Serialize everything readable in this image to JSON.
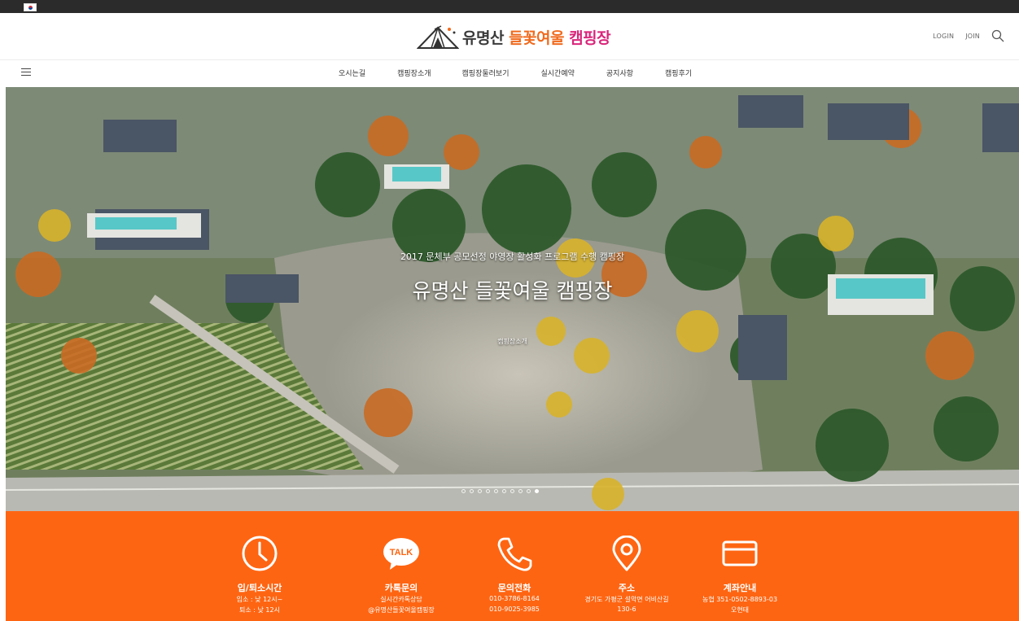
{
  "topbar": {
    "flag_icon": "korea-flag-icon"
  },
  "header": {
    "logo_part1": "유명산 ",
    "logo_part2": "들꽃여울 ",
    "logo_part3": "캠핑장",
    "login_label": "LOGIN",
    "join_label": "JOIN",
    "search_icon": "search-icon"
  },
  "nav": {
    "menu_icon": "hamburger-menu-icon",
    "items": [
      {
        "label": "오시는길"
      },
      {
        "label": "캠핑장소개"
      },
      {
        "label": "캠핑장둘러보기"
      },
      {
        "label": "실시간예약"
      },
      {
        "label": "공지사항"
      },
      {
        "label": "캠핑후기"
      }
    ]
  },
  "hero": {
    "subtitle": "2017 문체부 공모선정 야영장 활성화 프로그램 수행 캠핑장",
    "title": "유명산 들꽃여울 캠핑장",
    "button_label": "캠핑장소개",
    "slide_count": 10,
    "active_slide": 9
  },
  "colors": {
    "accent": "#fe6512",
    "topbar": "#2b2b2b"
  },
  "info": {
    "hours": {
      "icon": "clock-icon",
      "title": "입/퇴소시간",
      "lines": [
        "입소 : 낮 12시~",
        "퇴소 : 낮 12시"
      ]
    },
    "kakao": {
      "icon": "kakao-talk-icon",
      "icon_text": "TALK",
      "title": "카톡문의",
      "lines": [
        "실시간카톡상담",
        "@유명산들꽃여울캠핑장"
      ]
    },
    "phone": {
      "icon": "phone-icon",
      "title": "문의전화",
      "lines": [
        "010-3786-8164",
        "010-9025-3985"
      ]
    },
    "address": {
      "icon": "map-pin-icon",
      "title": "주소",
      "lines": [
        "경기도 가평군 설악면 어비산길",
        "130-6"
      ]
    },
    "account": {
      "icon": "credit-card-icon",
      "title": "계좌안내",
      "lines": [
        "농협 351-0502-8893-03",
        "오현태"
      ]
    }
  }
}
